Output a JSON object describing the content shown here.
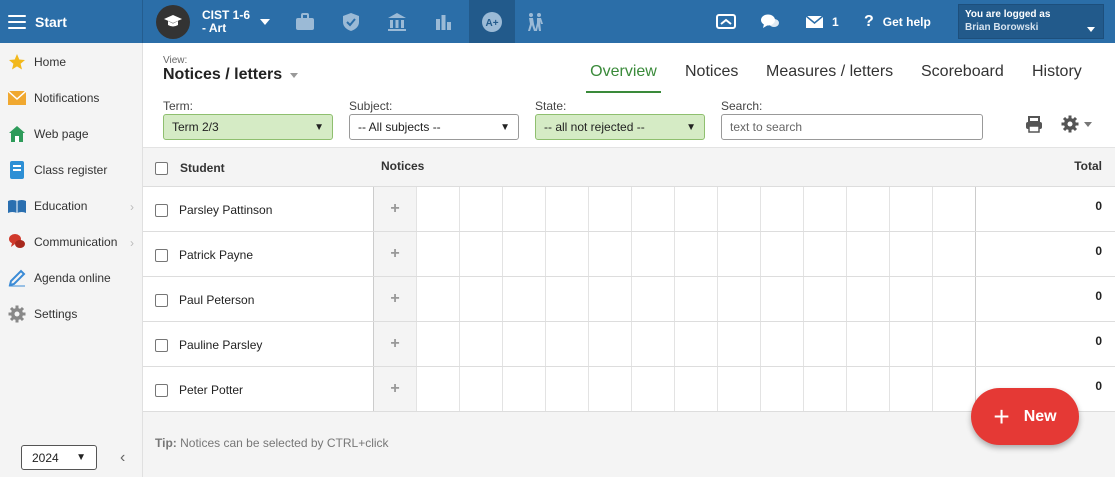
{
  "topbar": {
    "start_label": "Start",
    "class_line1": "CIST 1-6",
    "class_line2": "- Art",
    "messages_count": "1",
    "help_label": "Get help",
    "login_label": "You are logged as",
    "user_name": "Brian Borowski",
    "color": "#2b6ea8"
  },
  "sidebar": {
    "items": [
      {
        "label": "Home",
        "icon": "star-icon"
      },
      {
        "label": "Notifications",
        "icon": "envelope-icon"
      },
      {
        "label": "Web page",
        "icon": "house-icon"
      },
      {
        "label": "Class register",
        "icon": "book-icon"
      },
      {
        "label": "Education",
        "icon": "open-book-icon"
      },
      {
        "label": "Communication",
        "icon": "chat-icon"
      },
      {
        "label": "Agenda online",
        "icon": "pencil-icon"
      },
      {
        "label": "Settings",
        "icon": "gear-icon"
      }
    ],
    "year": "2024"
  },
  "view": {
    "label": "View:",
    "title": "Notices / letters"
  },
  "tabs": [
    "Overview",
    "Notices",
    "Measures / letters",
    "Scoreboard",
    "History"
  ],
  "filters": {
    "term_label": "Term:",
    "term_value": "Term 2/3",
    "subject_label": "Subject:",
    "subject_value": "-- All subjects --",
    "state_label": "State:",
    "state_value": "-- all not rejected --",
    "search_label": "Search:",
    "search_placeholder": "text to search"
  },
  "table": {
    "col_student": "Student",
    "col_notices": "Notices",
    "col_total": "Total",
    "rows": [
      {
        "name": "Parsley Pattinson",
        "total": "0"
      },
      {
        "name": "Patrick Payne",
        "total": "0"
      },
      {
        "name": "Paul Peterson",
        "total": "0"
      },
      {
        "name": "Pauline Parsley",
        "total": "0"
      },
      {
        "name": "Peter Potter",
        "total": "0"
      }
    ]
  },
  "tip": {
    "prefix": "Tip:",
    "text": "Notices can be selected by CTRL+click"
  },
  "fab": {
    "plus": "+",
    "label": "New"
  },
  "colors": {
    "accent_green": "#3a8a3a",
    "fab_red": "#e53935"
  }
}
